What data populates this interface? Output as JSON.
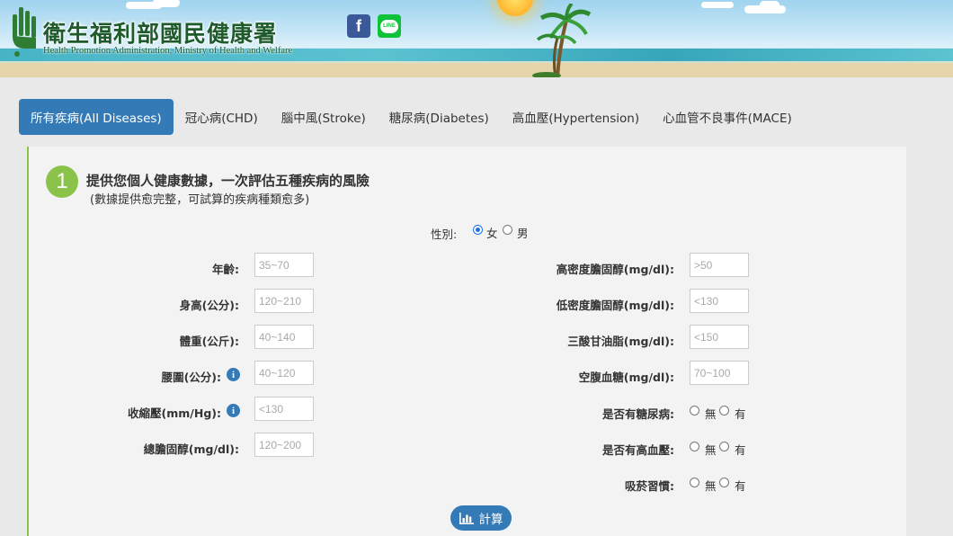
{
  "header": {
    "org_title": "衛生福利部國民健康署",
    "org_subtitle": "Health Promotion Administration, Ministry of Health and Welfare",
    "facebook_glyph": "f",
    "line_glyph": "LINE"
  },
  "tabs": [
    {
      "label": "所有疾病(All Diseases)",
      "active": true
    },
    {
      "label": "冠心病(CHD)",
      "active": false
    },
    {
      "label": "腦中風(Stroke)",
      "active": false
    },
    {
      "label": "糖尿病(Diabetes)",
      "active": false
    },
    {
      "label": "高血壓(Hypertension)",
      "active": false
    },
    {
      "label": "心血管不良事件(MACE)",
      "active": false
    }
  ],
  "section": {
    "step": "1",
    "title": "提供您個人健康數據，一次評估五種疾病的風險",
    "note": "(數據提供愈完整，可試算的疾病種類愈多)"
  },
  "gender": {
    "label": "性別:",
    "options": [
      "女",
      "男"
    ],
    "selected": "女"
  },
  "left_fields": [
    {
      "label": "年齡:",
      "placeholder": "35~70",
      "value": ""
    },
    {
      "label": "身高(公分):",
      "placeholder": "120~210",
      "value": ""
    },
    {
      "label": "體重(公斤):",
      "placeholder": "40~140",
      "value": ""
    },
    {
      "label": "腰圍(公分):",
      "placeholder": "40~120",
      "value": "",
      "info": "i"
    },
    {
      "label": "收縮壓(mm/Hg):",
      "placeholder": "<130",
      "value": "",
      "info": "i"
    },
    {
      "label": "總膽固醇(mg/dl):",
      "placeholder": "120~200",
      "value": ""
    }
  ],
  "right_fields": [
    {
      "label": "高密度膽固醇(mg/dl):",
      "placeholder": ">50",
      "value": ""
    },
    {
      "label": "低密度膽固醇(mg/dl):",
      "placeholder": "<130",
      "value": ""
    },
    {
      "label": "三酸甘油脂(mg/dl):",
      "placeholder": "<150",
      "value": ""
    },
    {
      "label": "空腹血糖(mg/dl):",
      "placeholder": "70~100",
      "value": ""
    }
  ],
  "yes_no": [
    {
      "label": "是否有糖尿病:",
      "options": [
        "無",
        "有"
      ],
      "selected": ""
    },
    {
      "label": "是否有高血壓:",
      "options": [
        "無",
        "有"
      ],
      "selected": ""
    },
    {
      "label": "吸菸習慣:",
      "options": [
        "無",
        "有"
      ],
      "selected": ""
    }
  ],
  "calculate": {
    "label": "計算",
    "icon": "bar-chart-icon"
  },
  "colors": {
    "primary": "#337ab7",
    "accent_green": "#8bc34a",
    "title_green": "#1e5a2b",
    "facebook": "#3b5998",
    "line": "#10c13a"
  }
}
